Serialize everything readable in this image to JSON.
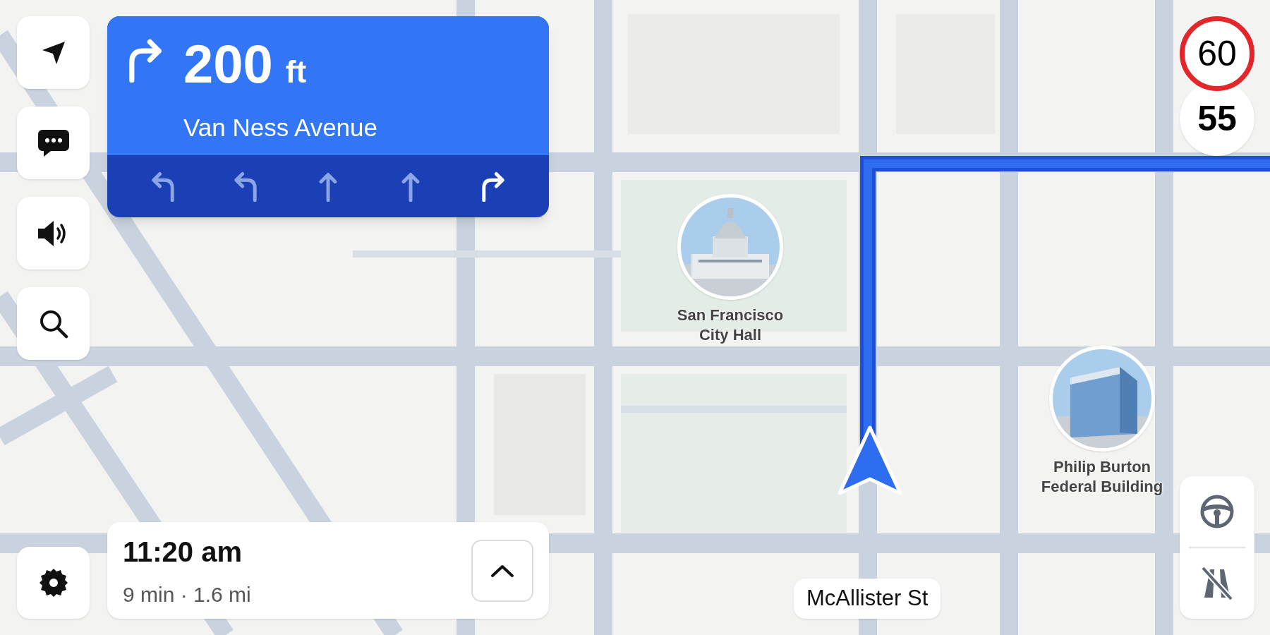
{
  "maneuver": {
    "kind": "right",
    "distance": "200",
    "unit": "ft",
    "street": "Van Ness Avenue",
    "lanes": [
      {
        "kind": "left",
        "recommended": false
      },
      {
        "kind": "left",
        "recommended": false
      },
      {
        "kind": "straight",
        "recommended": false
      },
      {
        "kind": "straight",
        "recommended": false
      },
      {
        "kind": "right",
        "recommended": true
      }
    ]
  },
  "side_buttons": [
    {
      "kind": "compass"
    },
    {
      "kind": "chat"
    },
    {
      "kind": "sound"
    },
    {
      "kind": "search"
    }
  ],
  "settings_button": {
    "kind": "settings"
  },
  "speed_limit": "60",
  "current_speed": "55",
  "places": [
    {
      "name": "San Francisco City Hall",
      "kind": "dome"
    },
    {
      "name": "Philip Burton Federal Building",
      "kind": "tower"
    }
  ],
  "eta": {
    "arrival": "11:20 am",
    "summary": "9 min · 1.6 mi"
  },
  "current_road": "McAllister St",
  "map_buttons": [
    {
      "kind": "steering"
    },
    {
      "kind": "avoid_highways"
    }
  ]
}
